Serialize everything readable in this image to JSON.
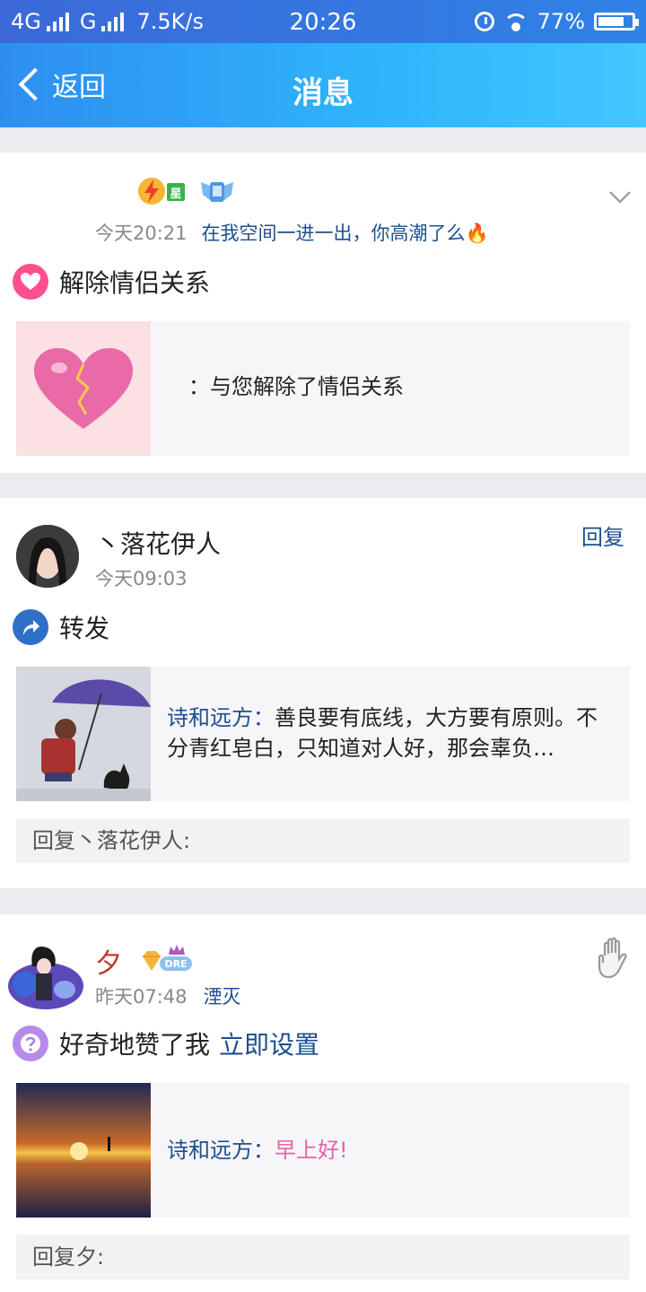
{
  "status_bar": {
    "network1": "4G",
    "network2": "G",
    "speed": "7.5K/s",
    "time": "20:26",
    "battery": "77%",
    "battery_level": 0.77
  },
  "header": {
    "back_label": "返回",
    "title": "消息"
  },
  "items": [
    {
      "badge1": "星",
      "time": "今天20:21",
      "status_text": "在我空间一进一出，你高潮了么🔥",
      "action": "解除情侣关系",
      "content": "：与您解除了情侣关系"
    },
    {
      "name": "丶落花伊人",
      "time": "今天09:03",
      "reply_button": "回复",
      "action": "转发",
      "content_author": "诗和远方：",
      "content": "善良要有底线，大方要有原则。不分青红皂白，只知道对人好，那会辜负…",
      "reply_placeholder": "回复丶落花伊人:"
    },
    {
      "name": "夕",
      "badge": "DRE",
      "time": "昨天07:48",
      "location": "湮灭",
      "action": "好奇地赞了我",
      "action_link": "立即设置",
      "content_author": "诗和远方：",
      "content": "早上好!",
      "reply_placeholder": "回复夕:"
    }
  ]
}
